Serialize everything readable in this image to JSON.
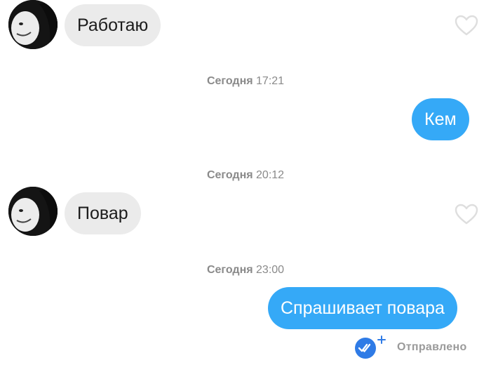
{
  "conversation": {
    "messages": [
      {
        "sender": "them",
        "text": "Работаю",
        "liked": false
      },
      {
        "sender": "me",
        "text": "Кем"
      },
      {
        "sender": "them",
        "text": "Повар",
        "liked": false
      },
      {
        "sender": "me",
        "text": "Спрашивает повара"
      }
    ],
    "timestamps": [
      {
        "day": "Сегодня",
        "time": "17:21"
      },
      {
        "day": "Сегодня",
        "time": "20:12"
      },
      {
        "day": "Сегодня",
        "time": "23:00"
      }
    ],
    "delivery_status": "Отправлено"
  },
  "icons": {
    "like": "heart-outline-icon",
    "status": "double-check-icon",
    "status_badge": "plus-icon"
  },
  "colors": {
    "outgoing_bubble": "#35a9f7",
    "incoming_bubble": "#ebebeb",
    "timestamp_text": "#8a8a8a",
    "status_icon": "#2f7be6"
  }
}
